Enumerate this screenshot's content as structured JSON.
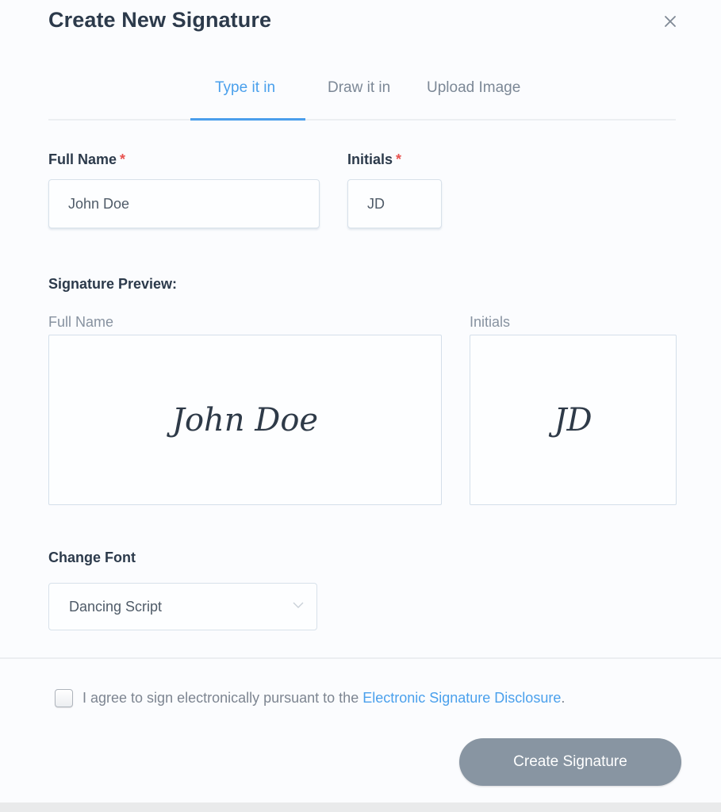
{
  "dialog": {
    "title": "Create New Signature",
    "close_icon": "close-icon"
  },
  "tabs": [
    {
      "label": "Type it in",
      "active": true
    },
    {
      "label": "Draw it in",
      "active": false
    },
    {
      "label": "Upload Image",
      "active": false
    }
  ],
  "form": {
    "full_name": {
      "label": "Full Name",
      "required_mark": "*",
      "value": "John Doe"
    },
    "initials": {
      "label": "Initials",
      "required_mark": "*",
      "value": "JD"
    }
  },
  "preview": {
    "heading": "Signature Preview:",
    "full_name_label": "Full Name",
    "initials_label": "Initials",
    "full_name_signature": "John Doe",
    "initials_signature": "JD"
  },
  "font": {
    "label": "Change Font",
    "selected": "Dancing Script",
    "chevron_icon": "chevron-down-icon"
  },
  "agreement": {
    "checked": false,
    "text": "I agree to sign electronically pursuant to the ",
    "link_text": "Electronic Signature Disclosure",
    "suffix": "."
  },
  "actions": {
    "create_label": "Create Signature"
  },
  "colors": {
    "accent": "#4aa0ec",
    "required": "#e8524f",
    "button_disabled": "#8895a2",
    "heading": "#2c3a4b"
  }
}
